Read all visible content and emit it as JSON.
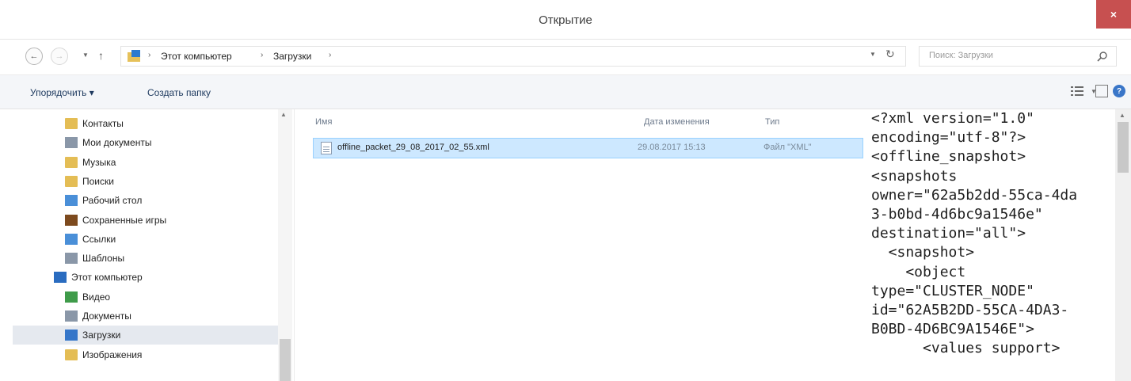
{
  "window": {
    "title": "Открытие",
    "close_label": "×"
  },
  "nav": {
    "back_icon": "←",
    "forward_icon": "→",
    "dropdown_icon": "▼",
    "up_icon": "↑",
    "breadcrumbs": [
      "Этот компьютер",
      "Загрузки"
    ],
    "separator": "›",
    "refresh_icon": "↻",
    "search_placeholder": "Поиск: Загрузки"
  },
  "toolbar": {
    "organize_label": "Упорядочить ▾",
    "new_folder_label": "Создать папку",
    "help_label": "?"
  },
  "sidebar": {
    "items": [
      {
        "label": "Контакты",
        "icon": "contacts-icon"
      },
      {
        "label": "Мои документы",
        "icon": "documents-icon"
      },
      {
        "label": "Музыка",
        "icon": "music-icon"
      },
      {
        "label": "Поиски",
        "icon": "searches-icon"
      },
      {
        "label": "Рабочий стол",
        "icon": "desktop-icon"
      },
      {
        "label": "Сохраненные игры",
        "icon": "saved-games-icon"
      },
      {
        "label": "Ссылки",
        "icon": "links-icon"
      },
      {
        "label": "Шаблоны",
        "icon": "templates-icon"
      },
      {
        "label": "Этот компьютер",
        "icon": "computer-icon"
      },
      {
        "label": "Видео",
        "icon": "video-icon"
      },
      {
        "label": "Документы",
        "icon": "documents-icon"
      },
      {
        "label": "Загрузки",
        "icon": "downloads-icon",
        "selected": true
      },
      {
        "label": "Изображения",
        "icon": "pictures-icon"
      }
    ]
  },
  "file_list": {
    "columns": [
      "Имя",
      "Дата изменения",
      "Тип"
    ],
    "rows": [
      {
        "name": "offline_packet_29_08_2017_02_55.xml",
        "date": "29.08.2017 15:13",
        "type": "Файл \"XML\""
      }
    ]
  },
  "preview": {
    "lines": [
      "<?xml version=\"1.0\"",
      "encoding=\"utf-8\"?>",
      "<offline_snapshot>",
      "<snapshots",
      "owner=\"62a5b2dd-55ca-4da",
      "3-b0bd-4d6bc9a1546e\"",
      "destination=\"all\">",
      "  <snapshot>",
      "    <object",
      "type=\"CLUSTER_NODE\"",
      "id=\"62A5B2DD-55CA-4DA3-",
      "B0BD-4D6BC9A1546E\">",
      "      <values support>"
    ]
  }
}
